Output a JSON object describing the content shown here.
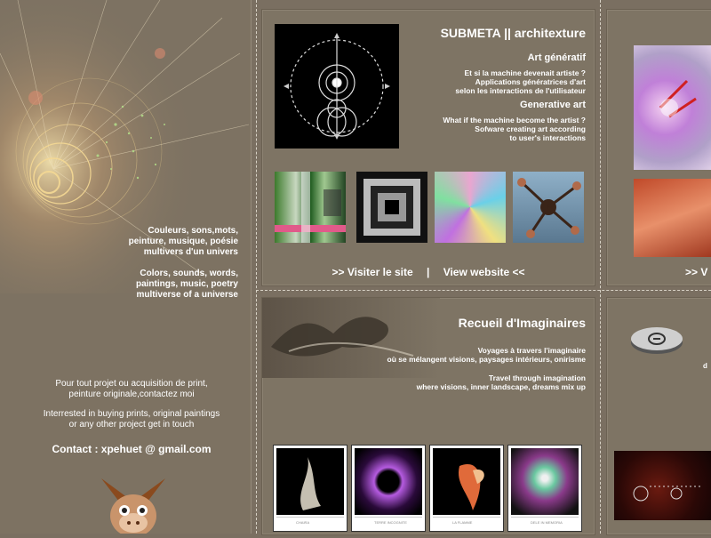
{
  "left": {
    "tagline_fr": [
      "Couleurs, sons,mots,",
      "peinture, musique, poésie",
      "multivers d'un univers"
    ],
    "tagline_en": [
      "Colors, sounds, words,",
      "paintings, music, poetry",
      "multiverse of a universe"
    ],
    "contact_fr": [
      "Pour tout projet ou acquisition de print,",
      "peinture originale,contactez moi"
    ],
    "contact_en": [
      "Interrested in buying prints, original paintings",
      "or any other project get in touch"
    ],
    "contact": "Contact : xpehuet @ gmail.com"
  },
  "submeta": {
    "title": "SUBMETA || architexture",
    "art_fr_heading": "Art génératif",
    "art_fr_lines": [
      "Et si la machine devenait artiste ?",
      "Applications génératrices d'art",
      "selon les interactions de l'utilisateur"
    ],
    "art_en_heading": "Generative art",
    "art_en_lines": [
      "What if the machine become the artist ?",
      "Sofware creating art according",
      "to user's interactions"
    ],
    "visit_fr": ">> Visiter le site",
    "separator": "|",
    "visit_en": "View website <<"
  },
  "recueil": {
    "title": "Recueil d'Imaginaires",
    "fr_lines": [
      "Voyages à travers l'imaginaire",
      "où se mélangent visions, paysages intérieurs, onirisme"
    ],
    "en_lines": [
      "Travel through imagination",
      "where visions, inner landscape, dreams mix up"
    ],
    "captions": [
      "CHAIRA",
      "TERRE INCOGNITE",
      "LA FLAMME",
      "DELE IN MEMORIA"
    ]
  },
  "right_top": {
    "link": ">> V"
  },
  "right_bottom": {
    "text": "d"
  },
  "colors": {
    "background": "#7a6f61",
    "panel": "#7e7464",
    "dash": "#d8d2c6"
  },
  "icons": [
    "logo-icon",
    "mascot-icon"
  ]
}
